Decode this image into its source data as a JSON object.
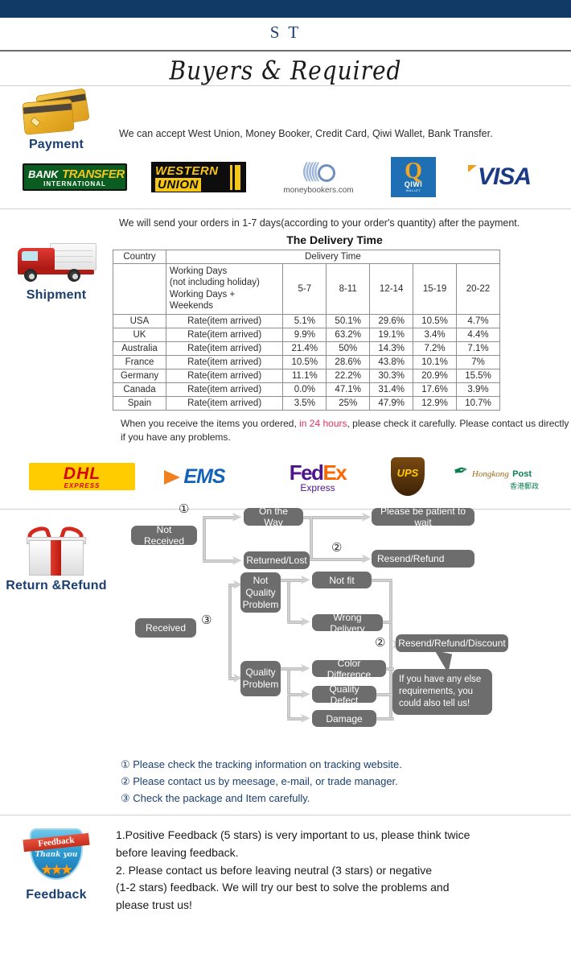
{
  "header": {
    "brand": "S T",
    "script_title": "Buyers & Required"
  },
  "payment": {
    "label": "Payment",
    "text": "We can accept West Union, Money Booker, Credit Card, Qiwi Wallet, Bank Transfer.",
    "logos": {
      "bank_transfer": {
        "t1": "BANK",
        "t2": "TRANSFER",
        "t3": "INTERNATIONAL"
      },
      "western_union": {
        "line1": "WESTERN",
        "line2": "UNION"
      },
      "moneybookers": {
        "name": "moneybookers",
        "suffix": ".com"
      },
      "qiwi": {
        "letter": "Q",
        "name": "QIWI",
        "sub": "WALLET"
      },
      "visa": {
        "name": "VISA"
      }
    }
  },
  "shipment": {
    "label": "Shipment",
    "note": "We will send your orders in 1-7 days(according to your order's quantity) after the payment.",
    "table_title": "The Delivery Time",
    "after_note_1": "When you receive the items you ordered, ",
    "after_note_hot": "in 24 hours",
    "after_note_2": ", please check it carefully. Please contact us directly if you have any problems.",
    "carriers": {
      "dhl": {
        "name": "DHL",
        "sub": "EXPRESS"
      },
      "ems": {
        "name": "EMS"
      },
      "fedex": {
        "fed": "Fed",
        "ex": "Ex",
        "sub": "Express"
      },
      "ups": {
        "name": "UPS"
      },
      "hkpost": {
        "t1": "Hongkong",
        "t2": "Post",
        "cn": "香港郵政"
      }
    }
  },
  "chart_data": {
    "type": "table",
    "title": "The Delivery Time",
    "header_row_1": {
      "country": "Country",
      "delivery_time": "Delivery Time"
    },
    "header_row_2": {
      "working_days": [
        "Working Days",
        "(not including holiday)",
        "Working Days + Weekends"
      ],
      "buckets": [
        "5-7",
        "8-11",
        "12-14",
        "15-19",
        "20-22"
      ]
    },
    "rate_label": "Rate(item arrived)",
    "categories": [
      "5-7",
      "8-11",
      "12-14",
      "15-19",
      "20-22"
    ],
    "rows": [
      {
        "country": "USA",
        "rate_label": "Rate(item arrived)",
        "values": [
          "5.1%",
          "50.1%",
          "29.6%",
          "10.5%",
          "4.7%"
        ]
      },
      {
        "country": "UK",
        "rate_label": "Rate(item arrived)",
        "values": [
          "9.9%",
          "63.2%",
          "19.1%",
          "3.4%",
          "4.4%"
        ]
      },
      {
        "country": "Australia",
        "rate_label": "Rate(item arrived)",
        "values": [
          "21.4%",
          "50%",
          "14.3%",
          "7.2%",
          "7.1%"
        ]
      },
      {
        "country": "France",
        "rate_label": "Rate(item arrived)",
        "values": [
          "10.5%",
          "28.6%",
          "43.8%",
          "10.1%",
          "7%"
        ]
      },
      {
        "country": "Germany",
        "rate_label": "Rate(item arrived)",
        "values": [
          "11.1%",
          "22.2%",
          "30.3%",
          "20.9%",
          "15.5%"
        ]
      },
      {
        "country": "Canada",
        "rate_label": "Rate(item arrived)",
        "values": [
          "0.0%",
          "47.1%",
          "31.4%",
          "17.6%",
          "3.9%"
        ]
      },
      {
        "country": "Spain",
        "rate_label": "Rate(item arrived)",
        "values": [
          "3.5%",
          "25%",
          "47.9%",
          "12.9%",
          "10.7%"
        ]
      }
    ]
  },
  "returns": {
    "label": "Return &Refund",
    "flow": {
      "not_received": "Not Received",
      "on_the_way": "On the Way",
      "returned_lost": "Returned/Lost",
      "please_wait": "Please be patient to wait",
      "resend_refund": "Resend/Refund",
      "received": "Received",
      "not_quality_problem": "Not\nQuality\nProblem",
      "not_fit": "Not fit",
      "wrong_delivery": "Wrong Delivery",
      "quality_problem": "Quality\nProblem",
      "color_difference": "Color Difference",
      "quality_defect": "Quality Defect",
      "damage": "Damage",
      "resend_refund_discount": "Resend/Refund/Discount",
      "bubble": "If you have any else requirements, you could also tell us!",
      "marker_1": "①",
      "marker_2a": "②",
      "marker_2b": "②",
      "marker_3": "③"
    },
    "notes": [
      "① Please check the tracking information on tracking website.",
      "② Please contact us by meesage, e-mail, or trade manager.",
      "③ Check the package and Item carefully."
    ]
  },
  "feedback": {
    "label": "Feedback",
    "badge": {
      "banner": "Feedback",
      "thanks": "Thank you",
      "stars": "★★★"
    },
    "lines": [
      "1.Positive Feedback (5 stars) is very important to us, please think twice",
      " before leaving feedback.",
      "2. Please contact us before leaving neutral (3 stars) or negative",
      "(1-2 stars) feedback. We will try our best to solve the problems and",
      " please trust us!"
    ]
  },
  "colors": {
    "navy": "#123a66",
    "flow_box": "#6d6d6d",
    "hot": "#e0335e",
    "note_blue": "#1b3f70"
  }
}
